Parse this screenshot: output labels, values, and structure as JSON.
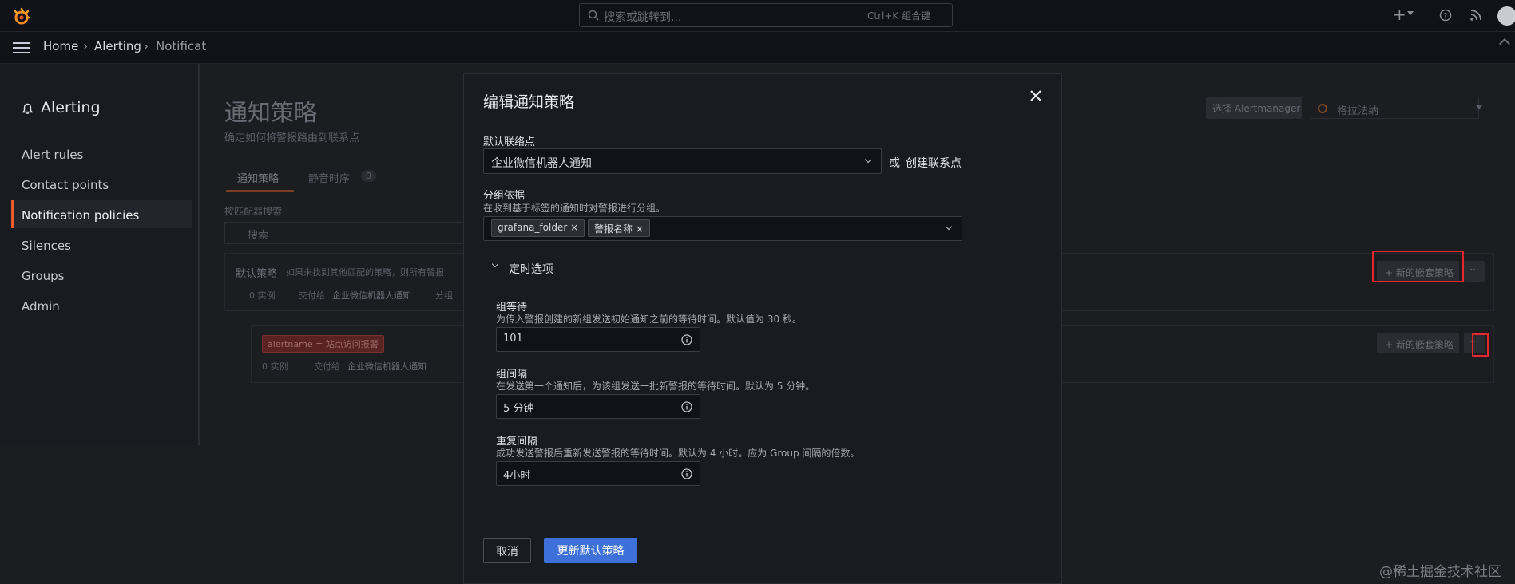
{
  "topbar": {
    "search_placeholder": "搜索或跳转到...",
    "shortcut": "Ctrl+K 组合键",
    "add_label": "+"
  },
  "breadcrumb": [
    "Home",
    "Alerting",
    "Notificat"
  ],
  "sidebar": {
    "title": "Alerting",
    "items": [
      {
        "label": "Alert rules"
      },
      {
        "label": "Contact points"
      },
      {
        "label": "Notification policies"
      },
      {
        "label": "Silences"
      },
      {
        "label": "Groups"
      },
      {
        "label": "Admin"
      }
    ],
    "active_index": 2
  },
  "page": {
    "title": "通知策略",
    "subtitle": "确定如何将警报路由到联系点",
    "tabs": [
      "通知策略",
      "静音时序"
    ],
    "silence_count": "0",
    "search_label": "按匹配器搜索",
    "search_placeholder": "搜索",
    "alertmanager_label": "选择 Alertmanager",
    "alertmanager_value": "格拉法纳",
    "default_policy": {
      "title": "默认策略",
      "desc": "如果未找到其他匹配的策略，则所有警报",
      "instances": "0 实例",
      "delivered_to": "交付给",
      "contact": "企业微信机器人通知",
      "grouped_by": "分组",
      "new_nested": "新的嵌套策略",
      "more": "···"
    },
    "nested_policy": {
      "matcher": "alertname = 站点访问报警",
      "instances": "0 实例",
      "delivered_to": "交付给",
      "contact": "企业微信机器人通知",
      "new_nested": "新的嵌套策略",
      "more": "···"
    }
  },
  "modal": {
    "title": "编辑通知策略",
    "default_contact_label": "默认联络点",
    "default_contact_value": "企业微信机器人通知",
    "or_text": "或",
    "create_contact_link": "创建联系点",
    "group_by_label": "分组依据",
    "group_by_desc": "在收到基于标签的通知时对警报进行分组。",
    "group_by_tags": [
      "grafana_folder",
      "警报名称"
    ],
    "timing_section": "定时选项",
    "group_wait_label": "组等待",
    "group_wait_desc": "为传入警报创建的新组发送初始通知之前的等待时间。默认值为 30 秒。",
    "group_wait_value": "101",
    "group_interval_label": "组间隔",
    "group_interval_desc": "在发送第一个通知后，为该组发送一批新警报的等待时间。默认为 5 分钟。",
    "group_interval_value": "5 分钟",
    "repeat_interval_label": "重复间隔",
    "repeat_interval_desc": "成功发送警报后重新发送警报的等待时间。默认为 4 小时。应为 Group 间隔的倍数。",
    "repeat_interval_value": "4小时",
    "cancel_button": "取消",
    "submit_button": "更新默认策略"
  },
  "watermark": "@稀土掘金技术社区",
  "colors": {
    "accent": "#3d71d9",
    "brand": "#f05a28",
    "highlight": "#e8262b"
  }
}
